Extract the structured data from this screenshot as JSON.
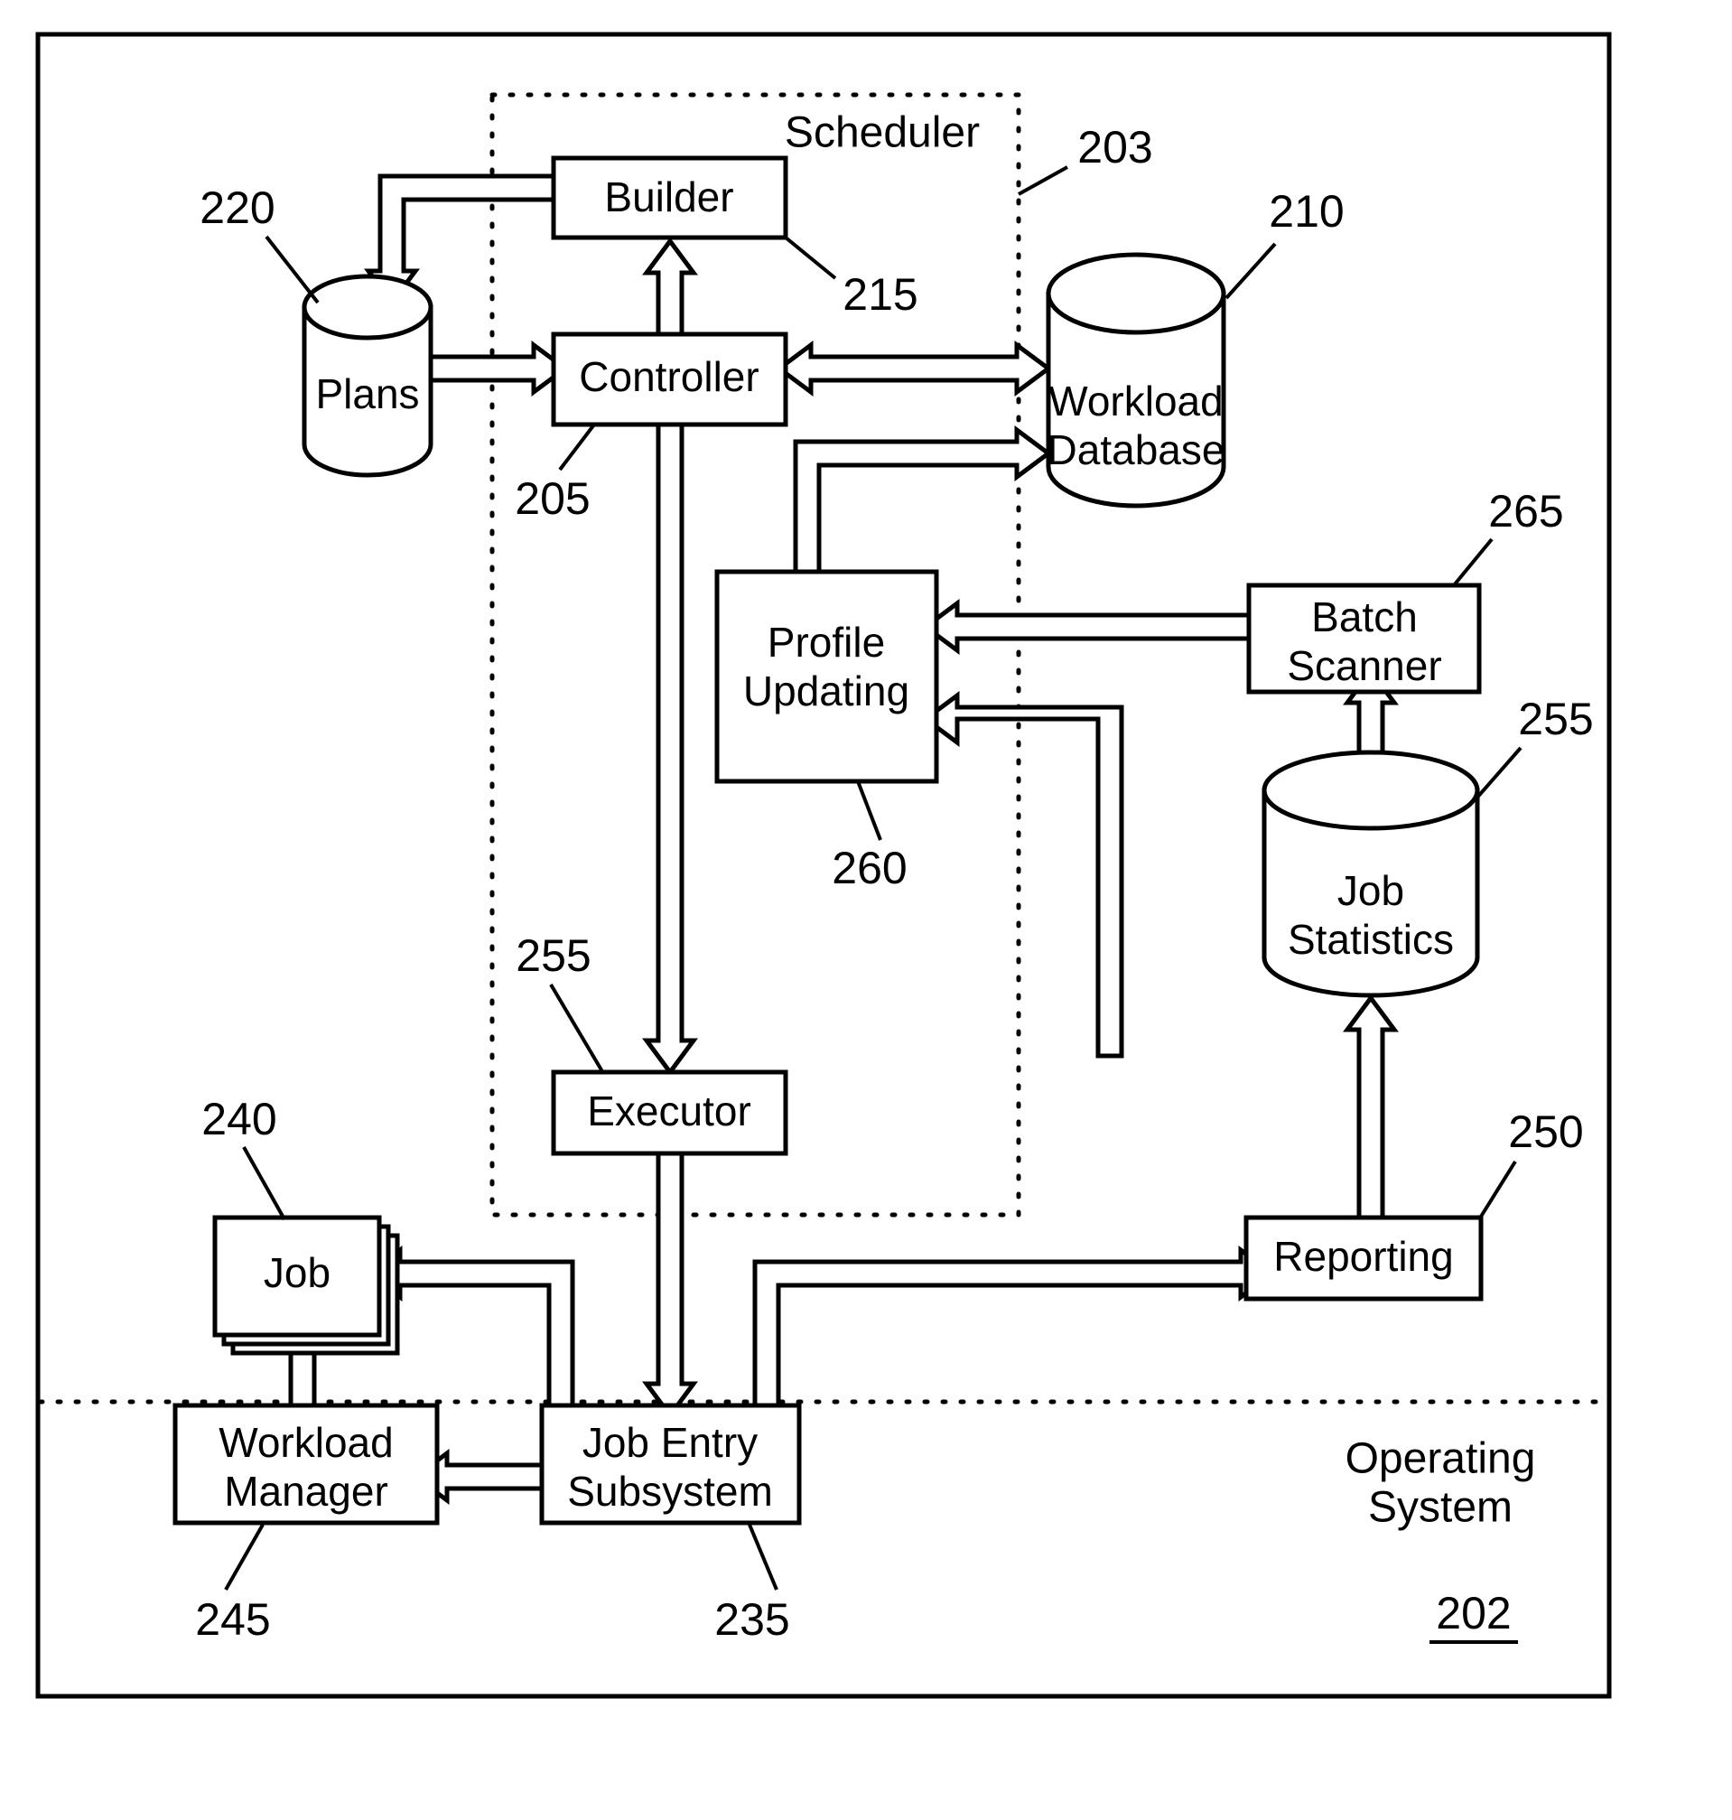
{
  "figure": {
    "type": "patent-block-diagram",
    "outer_region": {
      "label": "Operating System",
      "ref": "202"
    },
    "scheduler_region": {
      "label": "Scheduler",
      "ref": "203"
    },
    "nodes": [
      {
        "id": "builder",
        "label": "Builder",
        "ref": "215",
        "shape": "rect"
      },
      {
        "id": "controller",
        "label": "Controller",
        "ref": "205",
        "shape": "rect"
      },
      {
        "id": "plans",
        "label": "Plans",
        "ref": "220",
        "shape": "cylinder"
      },
      {
        "id": "workload_db",
        "label_line1": "Workload",
        "label_line2": "Database",
        "ref": "210",
        "shape": "cylinder"
      },
      {
        "id": "profile_updating",
        "label_line1": "Profile",
        "label_line2": "Updating",
        "ref": "260",
        "shape": "rect"
      },
      {
        "id": "batch_scanner",
        "label_line1": "Batch",
        "label_line2": "Scanner",
        "ref": "265",
        "shape": "rect"
      },
      {
        "id": "job_statistics",
        "label_line1": "Job",
        "label_line2": "Statistics",
        "ref": "255",
        "shape": "cylinder"
      },
      {
        "id": "executor",
        "label": "Executor",
        "ref": "255",
        "shape": "rect"
      },
      {
        "id": "reporting",
        "label": "Reporting",
        "ref": "250",
        "shape": "rect"
      },
      {
        "id": "job",
        "label": "Job",
        "ref": "240",
        "shape": "stacked-rect"
      },
      {
        "id": "workload_manager",
        "label_line1": "Workload",
        "label_line2": "Manager",
        "ref": "245",
        "shape": "rect"
      },
      {
        "id": "job_entry_subsystem",
        "label_line1": "Job Entry",
        "label_line2": "Subsystem",
        "ref": "235",
        "shape": "rect"
      }
    ],
    "ref_numbers": {
      "builder": "215",
      "controller": "205",
      "plans": "220",
      "workload_db": "210",
      "profile_updating": "260",
      "batch_scanner": "265",
      "job_statistics": "255",
      "executor": "255",
      "reporting": "250",
      "job": "240",
      "workload_manager": "245",
      "job_entry_subsystem": "235",
      "scheduler": "203",
      "operating_system": "202"
    },
    "connections": [
      {
        "from": "builder",
        "to": "plans",
        "direction": "one-way"
      },
      {
        "from": "plans",
        "to": "controller",
        "direction": "one-way"
      },
      {
        "from": "controller",
        "to": "builder",
        "direction": "one-way"
      },
      {
        "from": "controller",
        "to": "workload_db",
        "direction": "two-way"
      },
      {
        "from": "profile_updating",
        "to": "workload_db",
        "direction": "one-way"
      },
      {
        "from": "batch_scanner",
        "to": "profile_updating",
        "direction": "one-way"
      },
      {
        "from": "job_statistics",
        "to": "batch_scanner",
        "direction": "one-way"
      },
      {
        "from": "reporting",
        "to": "job_statistics",
        "direction": "one-way"
      },
      {
        "from": "reporting",
        "to": "profile_updating",
        "direction": "one-way"
      },
      {
        "from": "controller",
        "to": "executor",
        "direction": "two-way"
      },
      {
        "from": "executor",
        "to": "job_entry_subsystem",
        "direction": "two-way"
      },
      {
        "from": "job_entry_subsystem",
        "to": "job",
        "direction": "one-way"
      },
      {
        "from": "job_entry_subsystem",
        "to": "workload_manager",
        "direction": "one-way"
      },
      {
        "from": "job_entry_subsystem",
        "to": "reporting",
        "direction": "one-way"
      },
      {
        "from": "workload_manager",
        "to": "job",
        "direction": "one-way"
      }
    ]
  },
  "colors": {
    "line": "#000000",
    "fill": "#ffffff",
    "text": "#000000"
  }
}
